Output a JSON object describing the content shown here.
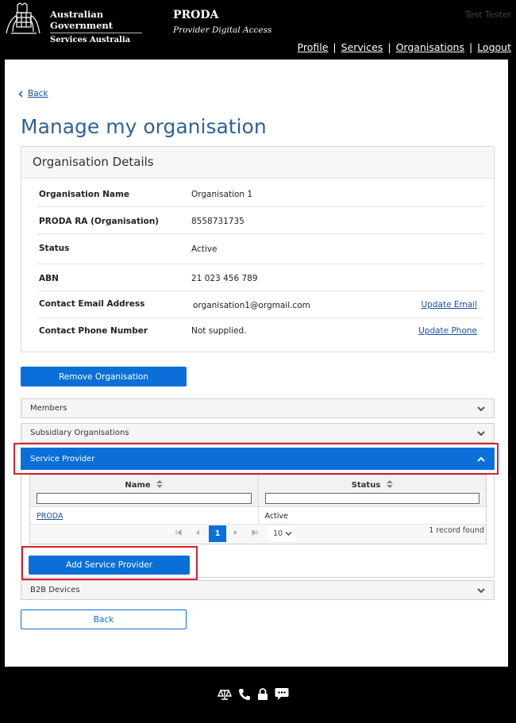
{
  "header": {
    "gov_line1": "Australian Government",
    "gov_line2": "Services Australia",
    "app_title": "PRODA",
    "app_subtitle": "Provider Digital Access",
    "user_name": "Test Tester",
    "nav": [
      {
        "label": "Profile"
      },
      {
        "label": "Services"
      },
      {
        "label": "Organisations"
      },
      {
        "label": "Logout"
      }
    ],
    "separator": "|"
  },
  "page": {
    "back_label": "Back",
    "title": "Manage my organisation"
  },
  "details": {
    "heading": "Organisation Details",
    "rows": [
      {
        "label": "Organisation Name",
        "value": "Organisation 1"
      },
      {
        "label": "PRODA RA (Organisation)",
        "value": "8558731735"
      },
      {
        "label": "Status",
        "value": "Active"
      },
      {
        "label": "ABN",
        "value": "21 023 456 789"
      },
      {
        "label": "Contact Email Address",
        "value": "organisation1@orgmail.com",
        "action": "Update Email"
      },
      {
        "label": "Contact Phone Number",
        "value": "Not supplied.",
        "action": "Update Phone"
      }
    ]
  },
  "buttons": {
    "remove": "Remove Organisation",
    "add_service_provider": "Add Service Provider",
    "back": "Back"
  },
  "accordion": {
    "members": "Members",
    "subsidiaries": "Subsidiary Organisations",
    "service_provider": "Service Provider",
    "b2b": "B2B Devices"
  },
  "sp_table": {
    "columns": [
      "Name",
      "Status"
    ],
    "rows": [
      {
        "name": "PRODA",
        "status": "Active"
      }
    ],
    "pager": {
      "current_page": "1",
      "page_size": "10",
      "record_count": "1 record found"
    }
  },
  "colors": {
    "primary": "#0a6fd8",
    "title": "#30619a",
    "highlight": "#d6202a",
    "link": "#1a4fa0"
  }
}
